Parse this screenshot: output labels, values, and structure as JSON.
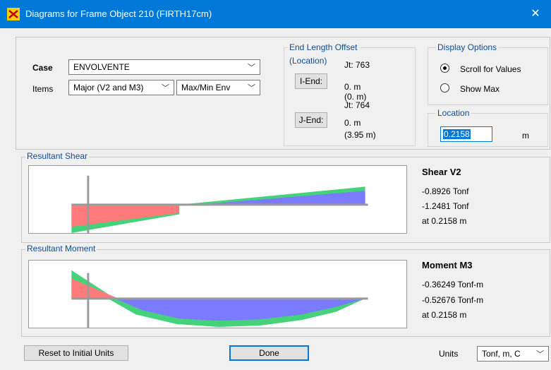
{
  "window": {
    "title": "Diagrams for Frame Object 210  (FIRTH17cm)",
    "icon": "etabs-app-icon",
    "close_glyph": "✕"
  },
  "case": {
    "label": "Case",
    "value": "ENVOLVENTE"
  },
  "items": {
    "label": "Items",
    "component_value": "Major (V2 and M3)",
    "type_value": "Max/Min Env"
  },
  "end_length_offset": {
    "title": "End Length Offset",
    "subtitle": "(Location)",
    "i_end": {
      "button": "I-End:",
      "jt": "Jt:  763",
      "offset": "0. m",
      "location": "(0. m)"
    },
    "j_end": {
      "button": "J-End:",
      "jt": "Jt:  764",
      "offset": "0. m",
      "location": "(3.95 m)"
    }
  },
  "display_options": {
    "title": "Display Options",
    "scroll_label": "Scroll for Values",
    "showmax_label": "Show Max",
    "selected": "scroll"
  },
  "location": {
    "title": "Location",
    "value": "0.2158",
    "unit": "m"
  },
  "shear": {
    "section_title": "Resultant Shear",
    "heading": "Shear V2",
    "value1": "-0.8926 Tonf",
    "value2": "-1.2481 Tonf",
    "at": "at 0.2158 m"
  },
  "moment": {
    "section_title": "Resultant Moment",
    "heading": "Moment M3",
    "value1": "-0.36249 Tonf-m",
    "value2": "-0.52676 Tonf-m",
    "at": "at 0.2158 m"
  },
  "footer": {
    "reset_label": "Reset to Initial Units",
    "done_label": "Done",
    "units_label": "Units",
    "units_value": "Tonf, m, C"
  },
  "colors": {
    "titlebar": "#0078d7",
    "positive": "#ff7b7b",
    "negative": "#7b7bff",
    "envelope": "#46d27a",
    "axis": "#9a9a9a",
    "group_label": "#0d4c94"
  }
}
